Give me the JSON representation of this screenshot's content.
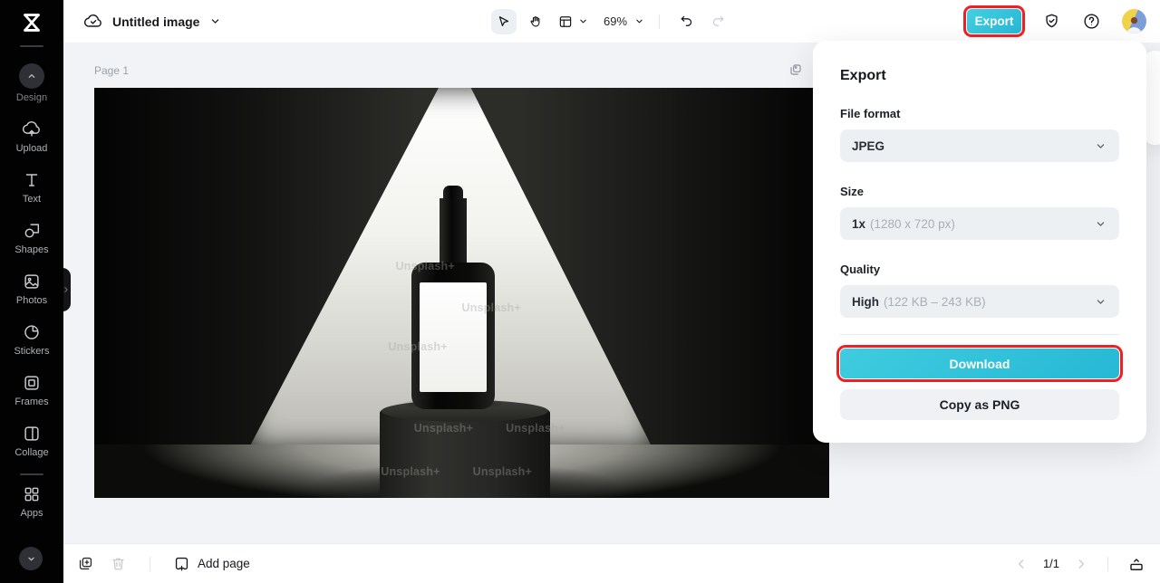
{
  "colors": {
    "accent": "#2bc4d9",
    "highlight_red": "#ee2024"
  },
  "topbar": {
    "title": "Untitled image",
    "zoom_value": "69%",
    "export_label": "Export"
  },
  "sidebar": {
    "items": [
      {
        "label": "Design"
      },
      {
        "label": "Upload"
      },
      {
        "label": "Text"
      },
      {
        "label": "Shapes"
      },
      {
        "label": "Photos"
      },
      {
        "label": "Stickers"
      },
      {
        "label": "Frames"
      },
      {
        "label": "Collage"
      },
      {
        "label": "Apps"
      }
    ]
  },
  "canvas": {
    "page_label": "Page 1",
    "watermark": "Unsplash+"
  },
  "export_panel": {
    "title": "Export",
    "file_format_label": "File format",
    "file_format_value": "JPEG",
    "size_label": "Size",
    "size_value": "1x",
    "size_detail": "(1280 x 720 px)",
    "quality_label": "Quality",
    "quality_value": "High",
    "quality_detail": "(122 KB – 243 KB)",
    "download_label": "Download",
    "copy_label": "Copy as PNG"
  },
  "bottombar": {
    "add_page_label": "Add page",
    "page_indicator": "1/1"
  }
}
